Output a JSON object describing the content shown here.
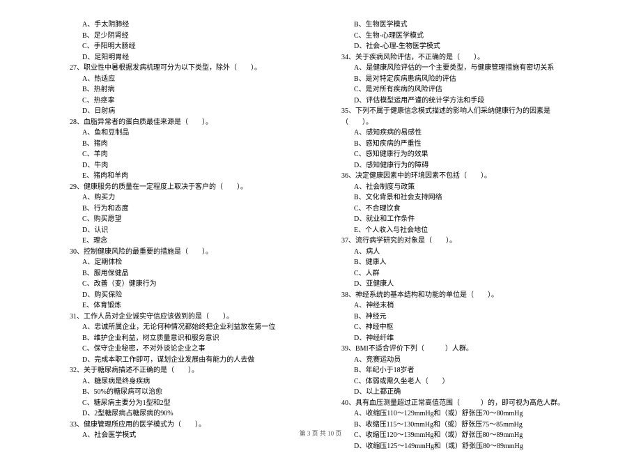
{
  "footer": "第 3 页  共 10 页",
  "left_column": [
    {
      "type": "option",
      "text": "A、手太阴肺经"
    },
    {
      "type": "option",
      "text": "B、足少阴肾经"
    },
    {
      "type": "option",
      "text": "C、手阳明大肠经"
    },
    {
      "type": "option",
      "text": "D、足阳明胃经"
    },
    {
      "type": "question",
      "text": "27、职业性中暑根据发病机理可分为以下类型，除外（　　）。"
    },
    {
      "type": "option",
      "text": "A、热适应"
    },
    {
      "type": "option",
      "text": "B、热射病"
    },
    {
      "type": "option",
      "text": "C、热痉挛"
    },
    {
      "type": "option",
      "text": "D、日射病"
    },
    {
      "type": "question",
      "text": "28、血脂异常者的蛋白质最佳来源是（　　）。"
    },
    {
      "type": "option",
      "text": "A、鱼和豆制品"
    },
    {
      "type": "option",
      "text": "B、猪肉"
    },
    {
      "type": "option",
      "text": "C、羊肉"
    },
    {
      "type": "option",
      "text": "D、牛肉"
    },
    {
      "type": "option",
      "text": "E、猪肉和羊肉"
    },
    {
      "type": "question",
      "text": "29、健康服务的质量在一定程度上取决于客户的（　　）。"
    },
    {
      "type": "option",
      "text": "A、购买力"
    },
    {
      "type": "option",
      "text": "B、行为和态度"
    },
    {
      "type": "option",
      "text": "C、购买愿望"
    },
    {
      "type": "option",
      "text": "D、认识"
    },
    {
      "type": "option",
      "text": "E、理念"
    },
    {
      "type": "question",
      "text": "30、控制健康风险的最重要的措施是（　　）。"
    },
    {
      "type": "option",
      "text": "A、定期体检"
    },
    {
      "type": "option",
      "text": "B、服用保健品"
    },
    {
      "type": "option",
      "text": "C、改善（变）健康行为"
    },
    {
      "type": "option",
      "text": "D、购买保险"
    },
    {
      "type": "option",
      "text": "E、体育锻炼"
    },
    {
      "type": "question",
      "text": "31、工作人员对企业诚实守信应该做到的是（　　）。"
    },
    {
      "type": "option",
      "text": "A、忠诚所属企业，无论何种情况都始终把企业利益放在第一位"
    },
    {
      "type": "option",
      "text": "B、维护企业利益，树立质量意识和服务意识"
    },
    {
      "type": "option",
      "text": "C、保守企业秘密，不对外谈论企业之事"
    },
    {
      "type": "option",
      "text": "D、完成本职工作即可，谋划企业发展由有能力的人去做"
    },
    {
      "type": "question",
      "text": "32、关于糖尿病描述不正确的是（　　）。"
    },
    {
      "type": "option",
      "text": "A、糖尿病是终身疾病"
    },
    {
      "type": "option",
      "text": "B、50%的糖尿病可以治愈"
    },
    {
      "type": "option",
      "text": "C、糖尿病主要分为1型和2型"
    },
    {
      "type": "option",
      "text": "D、2型糖尿病占糖尿病的90%"
    },
    {
      "type": "question",
      "text": "33、健康管理所应用的医学模式为（　　）。"
    },
    {
      "type": "option",
      "text": "A、社会医学模式"
    }
  ],
  "right_column": [
    {
      "type": "option",
      "text": "B、生物医学模式"
    },
    {
      "type": "option",
      "text": "C、生物-心理医学模式"
    },
    {
      "type": "option",
      "text": "D、社会-心理-生物医学模式"
    },
    {
      "type": "question",
      "text": "34、关于疾病风险评估，不正确的是（　　）。"
    },
    {
      "type": "option",
      "text": "A、是健康风险评估的一个主要类型，与健康管理措施有密切关系"
    },
    {
      "type": "option",
      "text": "B、是对特定疾病患病风险的评估"
    },
    {
      "type": "option",
      "text": "C、是对所有疾病的风险评估"
    },
    {
      "type": "option",
      "text": "D、评估模型运用严谨的统计学方法和手段"
    },
    {
      "type": "question",
      "text": "35、下列不属于健康信念模式描述的影响人们采纳健康行为的因素是（　　）。"
    },
    {
      "type": "option",
      "text": "A、感知疾病的易感性"
    },
    {
      "type": "option",
      "text": "B、感知疾病的严重性"
    },
    {
      "type": "option",
      "text": "C、感知健康行为的效果"
    },
    {
      "type": "option",
      "text": "D、感知健康行为的障碍"
    },
    {
      "type": "question",
      "text": "36、决定健康因素中的环境因素不包括（　　）。"
    },
    {
      "type": "option",
      "text": "A、社会制度与政策"
    },
    {
      "type": "option",
      "text": "B、文化背景和社会支持网络"
    },
    {
      "type": "option",
      "text": "C、不合理饮食"
    },
    {
      "type": "option",
      "text": "D、就业和工作条件"
    },
    {
      "type": "option",
      "text": "E、个人收入与社会地位"
    },
    {
      "type": "question",
      "text": "37、流行病学研究的对象是（　　）。"
    },
    {
      "type": "option",
      "text": "A、病人"
    },
    {
      "type": "option",
      "text": "B、健康人"
    },
    {
      "type": "option",
      "text": "C、人群"
    },
    {
      "type": "option",
      "text": "D、亚健康人"
    },
    {
      "type": "question",
      "text": "38、神经系统的基本结构和功能的单位是（　　）。"
    },
    {
      "type": "option",
      "text": "A、神经末梢"
    },
    {
      "type": "option",
      "text": "B、神经元"
    },
    {
      "type": "option",
      "text": "C、神经中枢"
    },
    {
      "type": "option",
      "text": "D、神经纤维"
    },
    {
      "type": "question",
      "text": "39、BMI不适合评价下列（　　　）人群。"
    },
    {
      "type": "option",
      "text": "A、竞赛运动员"
    },
    {
      "type": "option",
      "text": "B、年纪小于18岁者"
    },
    {
      "type": "option",
      "text": "C、体弱或需久坐老人（　　）"
    },
    {
      "type": "option",
      "text": "D、以上都正确"
    },
    {
      "type": "question",
      "text": "40、具有血压测量超过正常高值范围（　　　）的，即可视为高危人群。"
    },
    {
      "type": "option",
      "text": "A、收缩压110～129mmHg和（或）舒张压70～80mmHg"
    },
    {
      "type": "option",
      "text": "B、收缩压115～130mmHg和（或）舒张压75～85mmHg"
    },
    {
      "type": "option",
      "text": "C、收缩压120～139mmHg和（或）舒张压80～89mmHg"
    },
    {
      "type": "option",
      "text": "D、收缩压125～149mmHg和（或）舒张压80～89mmHg"
    }
  ]
}
